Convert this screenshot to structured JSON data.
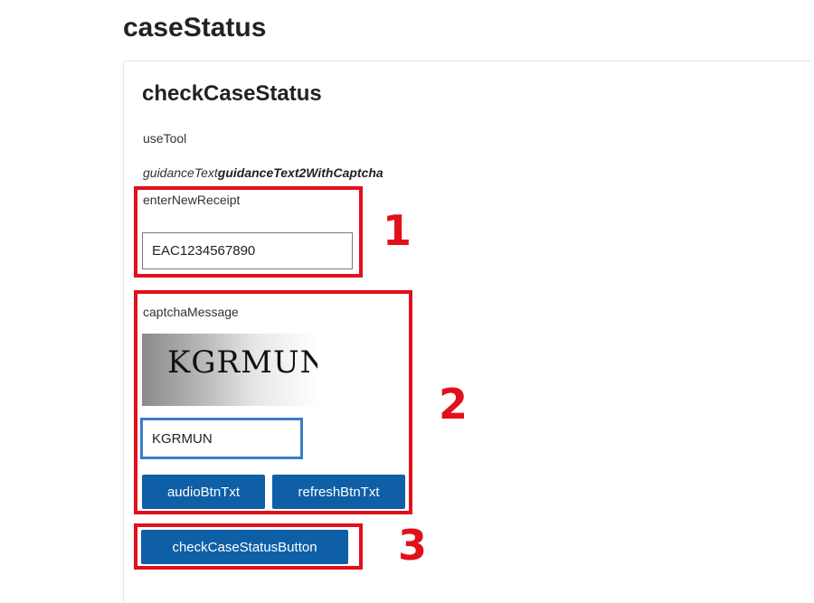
{
  "page": {
    "title": "caseStatus"
  },
  "section": {
    "title": "checkCaseStatus",
    "use_tool": "useTool",
    "guidance_prefix": "guidanceText",
    "guidance_bold": "guidanceText2WithCaptcha"
  },
  "receipt": {
    "label": "enterNewReceipt",
    "value": "EAC1234567890"
  },
  "captcha": {
    "label": "captchaMessage",
    "image_text": "KGRMUN",
    "input_value": "KGRMUN",
    "audio_button": "audioBtnTxt",
    "refresh_button": "refreshBtnTxt"
  },
  "actions": {
    "check_button": "checkCaseStatusButton"
  },
  "markers": [
    "1",
    "2",
    "3"
  ],
  "colors": {
    "highlight": "#e0111b",
    "button": "#0e5fa6",
    "focus_border": "#3a7dc9"
  }
}
